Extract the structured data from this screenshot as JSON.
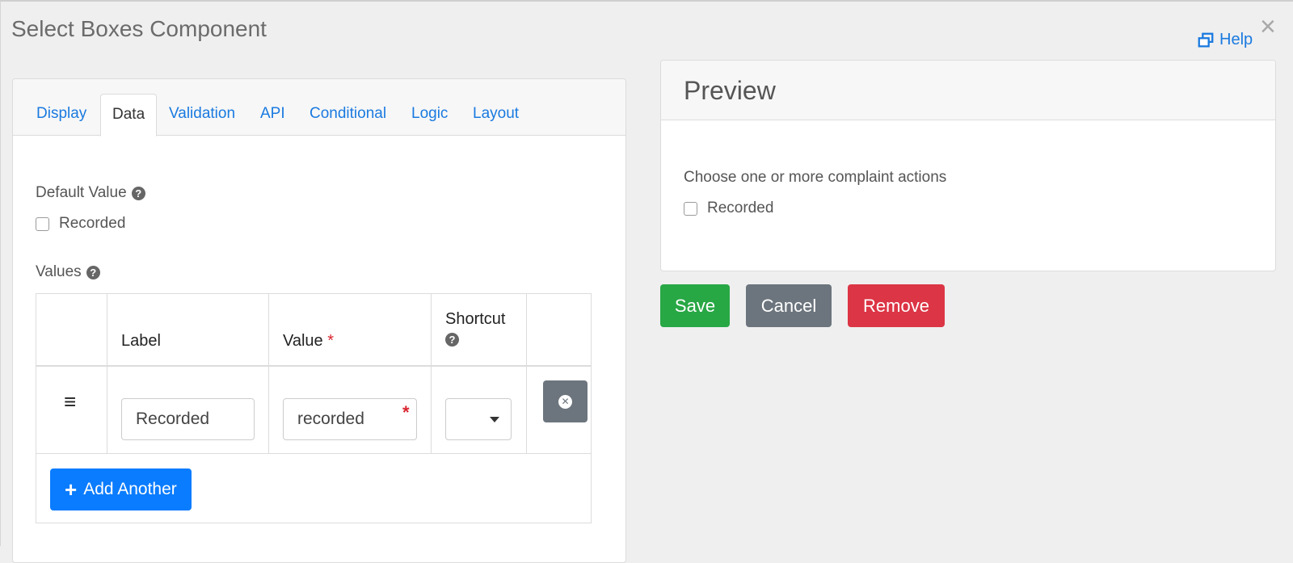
{
  "modal": {
    "title": "Select Boxes Component",
    "close_glyph": "×",
    "help_label": "Help"
  },
  "tabs": [
    {
      "label": "Display",
      "active": false
    },
    {
      "label": "Data",
      "active": true
    },
    {
      "label": "Validation",
      "active": false
    },
    {
      "label": "API",
      "active": false
    },
    {
      "label": "Conditional",
      "active": false
    },
    {
      "label": "Logic",
      "active": false
    },
    {
      "label": "Layout",
      "active": false
    }
  ],
  "data_tab": {
    "default_value": {
      "label": "Default Value",
      "options": [
        {
          "label": "Recorded",
          "checked": false
        }
      ]
    },
    "values": {
      "label": "Values",
      "columns": {
        "label": "Label",
        "value": "Value",
        "value_required_marker": "*",
        "shortcut": "Shortcut"
      },
      "rows": [
        {
          "label": "Recorded",
          "value": "recorded",
          "shortcut": ""
        }
      ],
      "add_button_label": "Add Another"
    }
  },
  "preview": {
    "title": "Preview",
    "field_label": "Choose one or more complaint actions",
    "options": [
      {
        "label": "Recorded",
        "checked": false
      }
    ]
  },
  "actions": {
    "save_label": "Save",
    "cancel_label": "Cancel",
    "remove_label": "Remove"
  },
  "colors": {
    "link": "#1a7ae0",
    "save": "#28a745",
    "cancel": "#6c757d",
    "remove": "#dc3545",
    "primary": "#0a7cff",
    "required": "#d9252f"
  },
  "icons": {
    "help": "external-window-icon",
    "close": "close-icon",
    "question": "question-circle-icon",
    "drag": "drag-handle-icon",
    "remove_row": "remove-circle-icon",
    "add": "plus-icon",
    "dropdown": "caret-down-icon"
  }
}
